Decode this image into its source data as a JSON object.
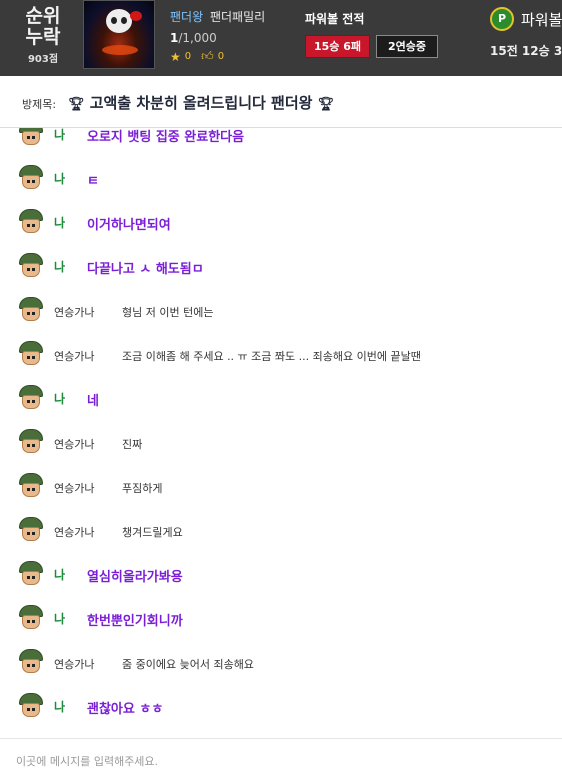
{
  "header": {
    "rank_line1": "순위",
    "rank_line2": "누락",
    "rank_score": "903점",
    "nickname": "팬더왕",
    "family": "팬더패밀리",
    "count_current": "1",
    "count_total": "/1,000",
    "stars": "0",
    "likes": "0",
    "record_title": "파워볼 전적",
    "record_badge": "15승 6패",
    "streak_badge": "2연승중",
    "powerball_icon": "P",
    "powerball_label": "파워볼",
    "powerball_record": "15전 12승 3"
  },
  "room": {
    "label": "방제목:",
    "title": "고액출 차분히 올려드립니다 팬더왕"
  },
  "messages": [
    {
      "sender": "나",
      "text": "오로지 뱃팅 집중 완료한다음",
      "mine": true
    },
    {
      "sender": "나",
      "text": "ㅌ",
      "mine": true
    },
    {
      "sender": "나",
      "text": "이거하나면되여",
      "mine": true
    },
    {
      "sender": "나",
      "text": "다끝나고 ㅅ 해도됨ㅁ",
      "mine": true
    },
    {
      "sender": "연승가나",
      "text": "형님 저 이번 턴에는",
      "mine": false
    },
    {
      "sender": "연승가나",
      "text": "조금 이해좀 해 주세요 .. ㅠ 조금 쫘도 ... 죄송해요 이번에 끝날땐",
      "mine": false
    },
    {
      "sender": "나",
      "text": "네",
      "mine": true
    },
    {
      "sender": "연승가나",
      "text": "진짜",
      "mine": false
    },
    {
      "sender": "연승가나",
      "text": "푸짐하게",
      "mine": false
    },
    {
      "sender": "연승가나",
      "text": "챙겨드릴게요",
      "mine": false
    },
    {
      "sender": "나",
      "text": "열심히올라가봐용",
      "mine": true
    },
    {
      "sender": "나",
      "text": "한번뿐인기회니까",
      "mine": true
    },
    {
      "sender": "연승가나",
      "text": "줌 중이에요 늦어서 죄송해요",
      "mine": false
    },
    {
      "sender": "나",
      "text": "괜찮아요 ㅎㅎ",
      "mine": true
    }
  ],
  "input": {
    "placeholder": "이곳에 메시지를 입력해주세요."
  }
}
